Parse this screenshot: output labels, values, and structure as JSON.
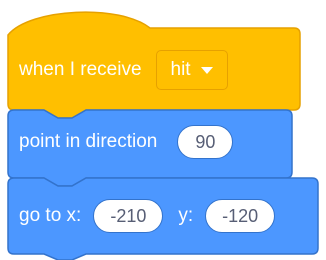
{
  "blocks": {
    "hat": {
      "label": "when I receive",
      "message": "hit",
      "color": "#ffbf00"
    },
    "point": {
      "label": "point in direction",
      "direction": "90",
      "color": "#4c97ff"
    },
    "goto": {
      "label_x": "go to x:",
      "x": "-210",
      "label_y": "y:",
      "y": "-120",
      "color": "#4c97ff"
    }
  },
  "icons": {
    "dropdown": "chevron-down-icon"
  }
}
